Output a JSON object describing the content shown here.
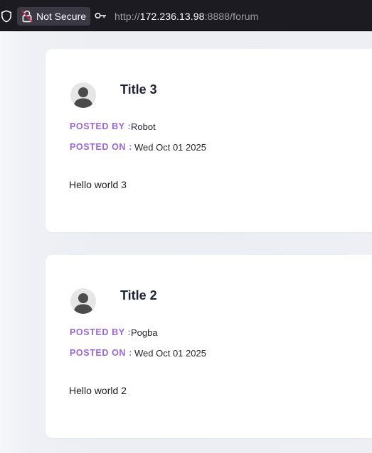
{
  "browser": {
    "security_label": "Not Secure",
    "url_scheme": "http://",
    "url_host": "172.236.13.98",
    "url_rest": ":8888/forum"
  },
  "posts": [
    {
      "title": "Title 3",
      "posted_by_label": "POSTED BY :",
      "posted_by": "Robot",
      "posted_on_label": "POSTED ON :",
      "posted_on": "Wed Oct 01 2025",
      "content": "Hello world 3"
    },
    {
      "title": "Title 2",
      "posted_by_label": "POSTED BY :",
      "posted_by": "Pogba",
      "posted_on_label": "POSTED ON :",
      "posted_on": "Wed Oct 01 2025",
      "content": "Hello world 2"
    }
  ],
  "colors": {
    "label_accent": "#9c66d6",
    "title": "#1e2235",
    "toolbar": "#1c1b22"
  },
  "icons": [
    "shield-icon",
    "insecure-lock-icon",
    "key-icon",
    "user-avatar-icon"
  ]
}
